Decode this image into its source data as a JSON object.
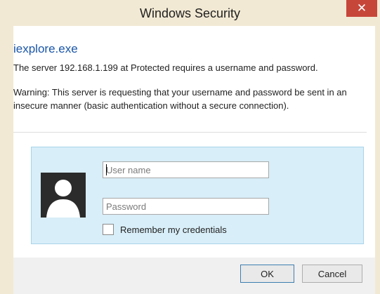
{
  "window": {
    "title": "Windows Security",
    "close_glyph": "✕",
    "accent_color": "#c7463a",
    "frame_color": "#f2e9d4"
  },
  "dialog": {
    "app_name": "iexplore.exe",
    "message": "The server 192.168.1.199 at Protected requires a username and password.",
    "warning": "Warning: This server is requesting that your username and password be sent in an insecure manner (basic authentication without a secure connection)."
  },
  "credentials": {
    "username_placeholder": "User name",
    "password_placeholder": "Password",
    "remember_label": "Remember my credentials",
    "remember_checked": false,
    "avatar_icon": "user-silhouette-icon"
  },
  "buttons": {
    "ok_label": "OK",
    "cancel_label": "Cancel"
  }
}
